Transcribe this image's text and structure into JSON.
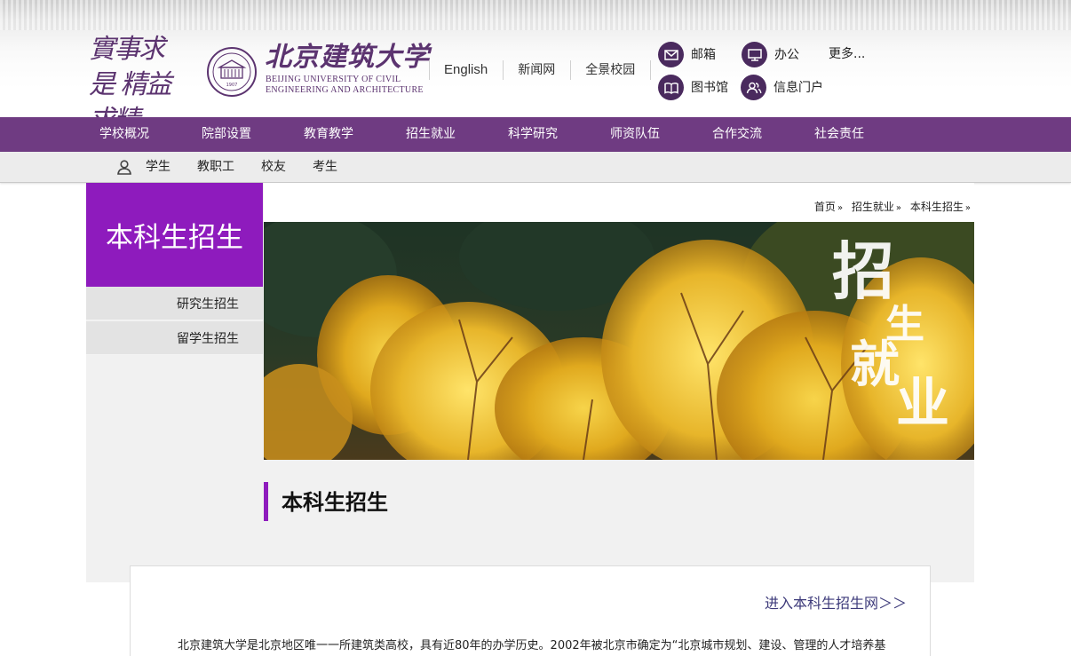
{
  "header": {
    "motto": "實事求是 精益求精",
    "university_cn": "北京建筑大学",
    "university_en_line1": "BEIJING UNIVERSITY OF CIVIL",
    "university_en_line2": "ENGINEERING AND ARCHITECTURE",
    "seal_year": "1907",
    "top_links": [
      "English",
      "新闻网",
      "全景校园"
    ],
    "quick_links": [
      {
        "label": "邮箱",
        "icon": "mail-icon"
      },
      {
        "label": "办公",
        "icon": "monitor-icon"
      },
      {
        "label": "更多..."
      },
      {
        "label": "图书馆",
        "icon": "book-icon"
      },
      {
        "label": "信息门户",
        "icon": "users-icon"
      }
    ]
  },
  "nav": {
    "items": [
      "学校概况",
      "院部设置",
      "教育教学",
      "招生就业",
      "科学研究",
      "师资队伍",
      "合作交流",
      "社会责任"
    ]
  },
  "subnav": {
    "icon": "person-icon",
    "items": [
      "学生",
      "教职工",
      "校友",
      "考生"
    ]
  },
  "breadcrumb": [
    "首页",
    "招生就业",
    "本科生招生"
  ],
  "sidebar": {
    "title": "本科生招生",
    "items": [
      "研究生招生",
      "留学生招生"
    ]
  },
  "banner": {
    "calligraphy": [
      "招",
      "生",
      "就",
      "业"
    ]
  },
  "main": {
    "section_title": "本科生招生",
    "enter_link": "进入本科生招生网＞＞",
    "paragraph": "北京建筑大学是北京地区唯一一所建筑类高校，具有近80年的办学历史。2002年被北京市确定为“北京城市规划、建设、管理的人才培养基"
  },
  "colors": {
    "brand_purple": "#6f3b82",
    "accent_purple": "#8e1bbd",
    "icon_purple": "#4a2a5e"
  }
}
